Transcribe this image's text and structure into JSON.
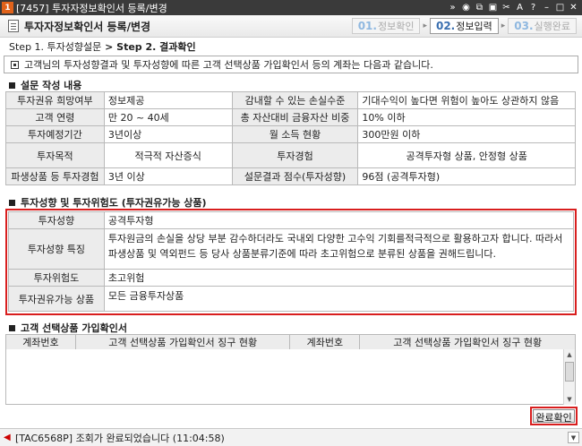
{
  "window": {
    "badge": "1",
    "title": "[7457] 투자자정보확인서 등록/변경",
    "icons": [
      "double-arrow-icon",
      "record-icon",
      "window-icon",
      "lock-icon",
      "tools-icon",
      "font-icon",
      "help-icon",
      "minimize-icon",
      "maximize-icon",
      "close-icon"
    ],
    "icon_glyphs": [
      "»",
      "◉",
      "⧉",
      "▣",
      "✂",
      "A",
      "?",
      "–",
      "□",
      "✕"
    ]
  },
  "header": {
    "title": "투자자정보확인서 등록/변경",
    "steps": [
      {
        "num": "01.",
        "label": "정보확인"
      },
      {
        "num": "02.",
        "label": "정보입력"
      },
      {
        "num": "03.",
        "label": "실행완료"
      }
    ],
    "step_separator": "▸"
  },
  "breadcrumb": {
    "step1": "Step 1. 투자성향설문",
    "sep": " > ",
    "step2": "Step 2. 결과확인"
  },
  "notice": "고객님의 투자성향결과 및 투자성향에 따른 고객 선택상품 가입확인서 등의 계좌는 다음과 같습니다.",
  "survey": {
    "section_title": "설문 작성 내용",
    "rows": [
      [
        "투자권유 희망여부",
        "정보제공",
        "감내할 수 있는 손실수준",
        "기대수익이 높다면 위험이 높아도 상관하지 않음"
      ],
      [
        "고객 연령",
        "만 20 ~ 40세",
        "총 자산대비 금융자산 비중",
        "10% 이하"
      ],
      [
        "투자예정기간",
        "3년이상",
        "월 소득 현황",
        "300만원 이하"
      ],
      [
        "투자목적",
        "적극적 자산증식",
        "투자경험",
        "공격투자형 상품, 안정형 상품"
      ],
      [
        "파생상품 등 투자경험",
        "3년 이상",
        "설문결과 점수(투자성향)",
        "96점 (공격투자형)"
      ]
    ]
  },
  "profile": {
    "section_title": "투자성향 및 투자위험도 (투자권유가능 상품)",
    "type_label": "투자성향",
    "type_value": "공격투자형",
    "feature_label": "투자성향 특징",
    "feature_value": "투자원금의 손실을 상당 부분 감수하더라도 국내외 다양한 고수익 기회를적극적으로 활용하고자 합니다. 따라서 파생상품 및 역외펀드 등 당사 상품분류기준에 따라 초고위험으로 분류된 상품을 권해드립니다.",
    "risk_label": "투자위험도",
    "risk_value": "초고위험",
    "products_label": "투자권유가능 상품",
    "products_value": "모든 금융투자상품"
  },
  "confirmation": {
    "section_title": "고객 선택상품 가입확인서",
    "columns": [
      "계좌번호",
      "고객 선택상품 가입확인서 징구 현황",
      "계좌번호",
      "고객 선택상품 가입확인서 징구 현황"
    ],
    "rows": []
  },
  "complete_button": "완료확인",
  "status": {
    "message": "[TAC6568P] 조회가 완료되었습니다 (11:04:58)"
  }
}
